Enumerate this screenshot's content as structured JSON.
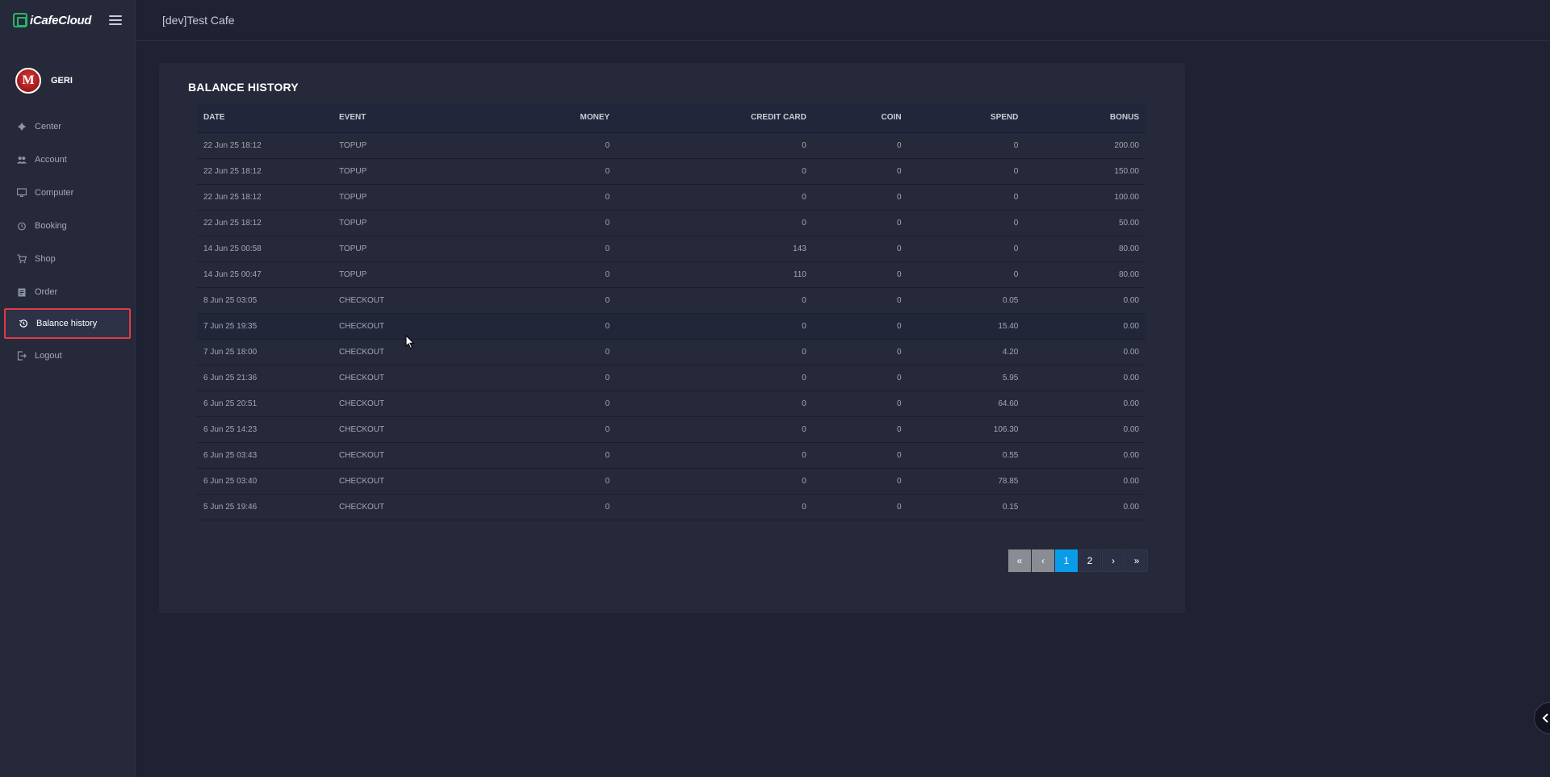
{
  "app": {
    "brand": "iCafeCloud"
  },
  "header": {
    "title": "[dev]Test Cafe"
  },
  "user": {
    "name": "GERI",
    "avatar_letter": "M"
  },
  "sidebar": {
    "items": [
      {
        "label": "Center",
        "icon": "gamepad-icon"
      },
      {
        "label": "Account",
        "icon": "users-icon"
      },
      {
        "label": "Computer",
        "icon": "monitor-icon"
      },
      {
        "label": "Booking",
        "icon": "alarm-icon"
      },
      {
        "label": "Shop",
        "icon": "cart-icon"
      },
      {
        "label": "Order",
        "icon": "clipboard-icon"
      },
      {
        "label": "Balance history",
        "icon": "history-icon",
        "active": true
      },
      {
        "label": "Logout",
        "icon": "logout-icon"
      }
    ]
  },
  "balance": {
    "title": "BALANCE HISTORY",
    "columns": [
      "DATE",
      "EVENT",
      "MONEY",
      "CREDIT CARD",
      "COIN",
      "SPEND",
      "BONUS"
    ],
    "rows": [
      [
        "22 Jun 25 18:12",
        "TOPUP",
        "0",
        "0",
        "0",
        "0",
        "200.00"
      ],
      [
        "22 Jun 25 18:12",
        "TOPUP",
        "0",
        "0",
        "0",
        "0",
        "150.00"
      ],
      [
        "22 Jun 25 18:12",
        "TOPUP",
        "0",
        "0",
        "0",
        "0",
        "100.00"
      ],
      [
        "22 Jun 25 18:12",
        "TOPUP",
        "0",
        "0",
        "0",
        "0",
        "50.00"
      ],
      [
        "14 Jun 25 00:58",
        "TOPUP",
        "0",
        "143",
        "0",
        "0",
        "80.00"
      ],
      [
        "14 Jun 25 00:47",
        "TOPUP",
        "0",
        "110",
        "0",
        "0",
        "80.00"
      ],
      [
        "8 Jun 25 03:05",
        "CHECKOUT",
        "0",
        "0",
        "0",
        "0.05",
        "0.00"
      ],
      [
        "7 Jun 25 19:35",
        "CHECKOUT",
        "0",
        "0",
        "0",
        "15.40",
        "0.00"
      ],
      [
        "7 Jun 25 18:00",
        "CHECKOUT",
        "0",
        "0",
        "0",
        "4.20",
        "0.00"
      ],
      [
        "6 Jun 25 21:36",
        "CHECKOUT",
        "0",
        "0",
        "0",
        "5.95",
        "0.00"
      ],
      [
        "6 Jun 25 20:51",
        "CHECKOUT",
        "0",
        "0",
        "0",
        "64.60",
        "0.00"
      ],
      [
        "6 Jun 25 14:23",
        "CHECKOUT",
        "0",
        "0",
        "0",
        "106.30",
        "0.00"
      ],
      [
        "6 Jun 25 03:43",
        "CHECKOUT",
        "0",
        "0",
        "0",
        "0.55",
        "0.00"
      ],
      [
        "6 Jun 25 03:40",
        "CHECKOUT",
        "0",
        "0",
        "0",
        "78.85",
        "0.00"
      ],
      [
        "5 Jun 25 19:46",
        "CHECKOUT",
        "0",
        "0",
        "0",
        "0.15",
        "0.00"
      ]
    ]
  },
  "pagination": {
    "first": "«",
    "prev": "‹",
    "pages": [
      "1",
      "2"
    ],
    "current": "1",
    "next": "›",
    "last": "»"
  },
  "colors": {
    "accent": "#0a9be8",
    "active_border": "#e03a44",
    "brand_green": "#29b46a"
  }
}
